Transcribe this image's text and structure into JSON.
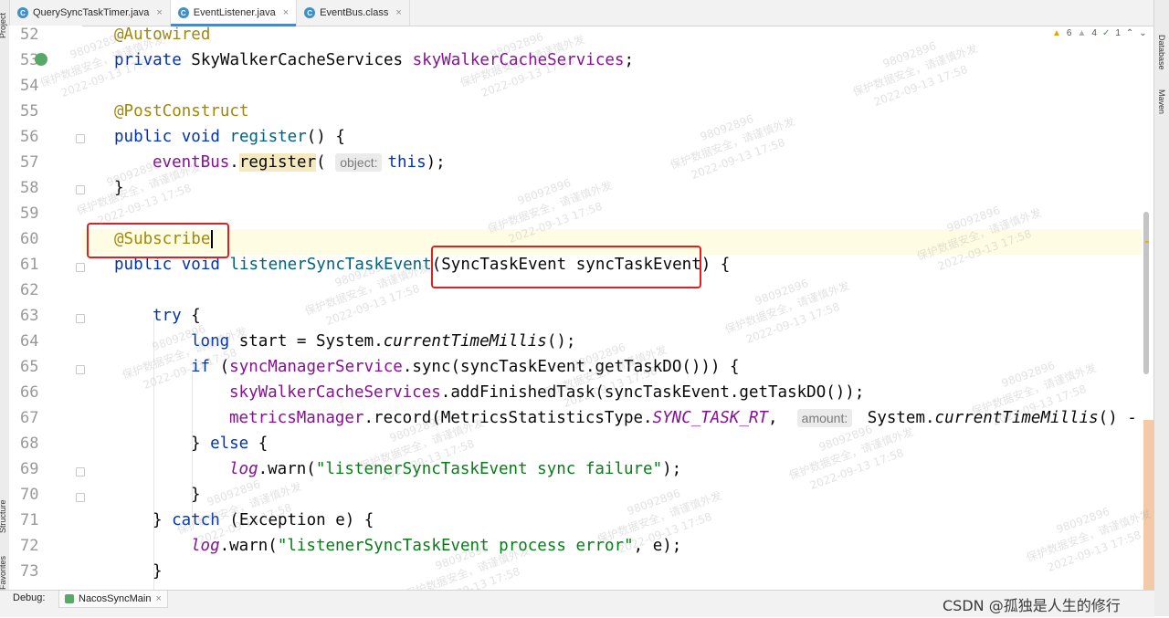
{
  "tabs": [
    {
      "label": "QuerySyncTaskTimer.java",
      "icon": "C",
      "active": false
    },
    {
      "label": "EventListener.java",
      "icon": "C",
      "active": true
    },
    {
      "label": "EventBus.class",
      "icon": "C",
      "active": false
    }
  ],
  "tab_close": "×",
  "left_tools": {
    "project": "Project",
    "structure": "Structure",
    "favorites": "Favorites"
  },
  "right_tools": {
    "database": "Database",
    "maven": "Maven"
  },
  "inspections": {
    "warnings_a": "6",
    "warnings_b": "4",
    "ok": "1"
  },
  "lines": {
    "n52": "52",
    "n53": "53",
    "n54": "54",
    "n55": "55",
    "n56": "56",
    "n57": "57",
    "n58": "58",
    "n59": "59",
    "n60": "60",
    "n61": "61",
    "n62": "62",
    "n63": "63",
    "n64": "64",
    "n65": "65",
    "n66": "66",
    "n67": "67",
    "n68": "68",
    "n69": "69",
    "n70": "70",
    "n71": "71",
    "n72": "72",
    "n73": "73"
  },
  "code": {
    "autowired": "@Autowired",
    "l53_private": "private",
    "l53_type": " SkyWalkerCacheServices ",
    "l53_field": "skyWalkerCacheServices",
    "semicolon": ";",
    "postconstruct": "@PostConstruct",
    "public": "public",
    "void": "void",
    "register_name": " register",
    "parens_open": "() {",
    "eventbus": "eventBus",
    "dot": ".",
    "register_call": "register",
    "lparen": "(",
    "hint_object": "object:",
    "this_kw": "this",
    "close_semicolon": ");",
    "close_brace": "}",
    "subscribe": "@Subscribe",
    "listener_name": " listenerSyncTaskEvent",
    "listener_params": "(SyncTaskEvent syncTaskEvent)",
    "brace_open": " {",
    "try_kw": "try",
    "long_kw": "long",
    "l64_rest": " start = System.",
    "current_time": "currentTimeMillis",
    "l64_end": "();",
    "if_kw": "if",
    "l65_a": " (",
    "sync_manager": "syncManagerService",
    "l65_b": ".sync(syncTaskEvent.getTaskDO())) {",
    "sky_field": "skyWalkerCacheServices",
    "l66_rest": ".addFinishedTask(syncTaskEvent.getTaskDO());",
    "metrics": "metricsManager",
    "l67_a": ".record(MetricsStatisticsType.",
    "sync_rt": "SYNC_TASK_RT",
    "comma": ",",
    "hint_amount": "amount:",
    "l67_b": " System.",
    "l67_c": "() - star",
    "else_close": "} ",
    "else_kw": "else",
    "log": "log",
    "warn": ".warn(",
    "str_sync_failure": "\"listenerSyncTaskEvent sync failure\"",
    "catch_close": "} ",
    "catch_kw": "catch",
    "catch_rest": " (Exception e) {",
    "str_process_error": "\"listenerSyncTaskEvent process error\"",
    "l72_end": ", e);"
  },
  "debug": {
    "label": "Debug:",
    "tab": "NacosSyncMain",
    "close": "×"
  },
  "watermark": {
    "id": "98092896",
    "text": "保护数据安全，请谨慎外发",
    "time": "2022-09-13 17:58"
  },
  "footer_credit": "CSDN @孤独是人生的修行",
  "colors": {
    "keyword": "#0033b3",
    "annotation": "#9e880d",
    "field": "#871094",
    "string": "#067d17",
    "highlight_box": "#e02020"
  }
}
